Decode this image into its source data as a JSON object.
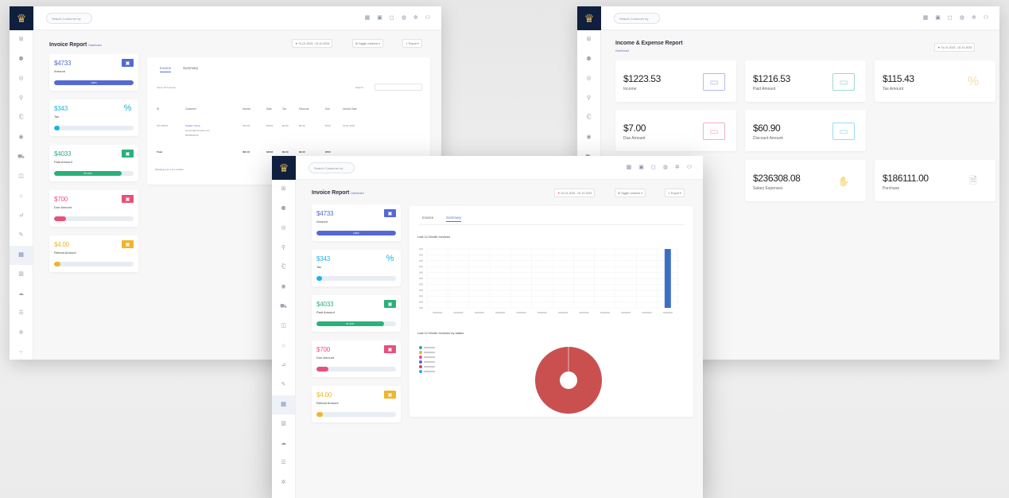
{
  "colors": {
    "blue": "#5469d4",
    "cyan": "#1ab4e6",
    "green": "#2bb07a",
    "pink": "#e8507a",
    "yellow": "#f0b52a",
    "brand": "#0f1f3d"
  },
  "common": {
    "search_placeholder": "Search Customer by",
    "toggle_label": "Toggle columns",
    "export_label": "Export",
    "date_range": "01-01-2023 - 02-10-2023",
    "breadcrumb_dashboard": "Dashboard",
    "breadcrumb_current": "Invoice Report",
    "breadcrumb_current_income": "Income & Expense Report"
  },
  "invoice_report": {
    "title": "Invoice Report",
    "tabs": [
      "Invoice",
      "Summary"
    ],
    "stat_cards": [
      {
        "value": "$4733",
        "label": "Amount",
        "icon": "money-icon",
        "color": "#5469d4",
        "fill": 1.0,
        "bar_text": "100%"
      },
      {
        "value": "$343",
        "label": "Tax",
        "icon": "percent-icon",
        "color": "#1ab4e6",
        "fill": 0.07,
        "bar_text": ""
      },
      {
        "value": "$4033",
        "label": "Paid Amount",
        "icon": "money-icon",
        "color": "#2bb07a",
        "fill": 0.85,
        "bar_text": "85.19%"
      },
      {
        "value": "$700",
        "label": "Due Amount",
        "icon": "money-icon",
        "color": "#e8507a",
        "fill": 0.15,
        "bar_text": ""
      },
      {
        "value": "$4.00",
        "label": "Refund Amount",
        "icon": "money-icon",
        "color": "#f0b52a",
        "fill": 0.08,
        "bar_text": ""
      }
    ]
  },
  "invoice_table": {
    "show_label": "Show",
    "entries_value": "10",
    "entries_label": "entries",
    "search_label": "Search:",
    "columns": [
      "ID",
      "Customer",
      "Invoice",
      "Date",
      "Tax",
      "Discount",
      "Due",
      "Invoice Date"
    ],
    "row": [
      "INV-00001",
      "Natalia Tuinen",
      "INV-01",
      "$4033",
      "$0.00",
      "$0.00",
      "$700",
      "01-01-2023"
    ],
    "row_customer_extra": [
      "support@example.com",
      "9876543210"
    ],
    "total_row": [
      "Total",
      "",
      "INV-01",
      "$4033",
      "$0.00",
      "$0.00",
      "$700",
      ""
    ],
    "footer": "Showing 1 to 1 of 1 entries"
  },
  "income_report": {
    "title": "Income & Expense Report",
    "cards": [
      {
        "value": "$1223.53",
        "label": "Income",
        "icon": "cash-icon",
        "color": "#5469d4"
      },
      {
        "value": "$1216.53",
        "label": "Paid Amount",
        "icon": "cash-icon",
        "color": "#2bb07a"
      },
      {
        "value": "$115.43",
        "label": "Tax Amount",
        "icon": "percent-icon",
        "color": "#f0b52a"
      },
      {
        "value": "$7.00",
        "label": "Due Amount",
        "icon": "cash-icon",
        "color": "#e8507a"
      },
      {
        "value": "$60.90",
        "label": "Discount Amount",
        "icon": "cash-icon",
        "color": "#1ab4e6"
      },
      {
        "value": "$236308.08",
        "label": "Salary Expenses",
        "icon": "hand-coin-icon",
        "color": "#f0b52a"
      },
      {
        "value": "$186111.00",
        "label": "Purchase",
        "icon": "invoice-icon",
        "color": "#888888"
      }
    ]
  },
  "summary": {
    "bar_title": "Last 12 Month Invoices",
    "pie_title": "Last 12 Month Invoices by status"
  },
  "chart_data": [
    {
      "type": "bar",
      "title": "Last 12 Month Invoices",
      "categories": [
        "",
        "",
        "",
        "",
        "",
        "",
        "",
        "",
        "",
        "",
        "",
        ""
      ],
      "values": [
        0,
        0,
        0,
        0,
        0,
        0,
        0,
        0,
        0,
        0,
        0,
        1
      ],
      "ylim": [
        0,
        1
      ],
      "grid": true
    },
    {
      "type": "pie",
      "title": "Last 12 Month Invoices by status",
      "slices": [
        {
          "value": 100,
          "color": "#c9504f"
        }
      ],
      "legend": [
        {
          "color": "#2bb07a"
        },
        {
          "color": "#f0b52a"
        },
        {
          "color": "#e8507a"
        },
        {
          "color": "#5469d4"
        },
        {
          "color": "#c9504f"
        },
        {
          "color": "#1ab4e6"
        }
      ],
      "legend_position": "left"
    }
  ]
}
